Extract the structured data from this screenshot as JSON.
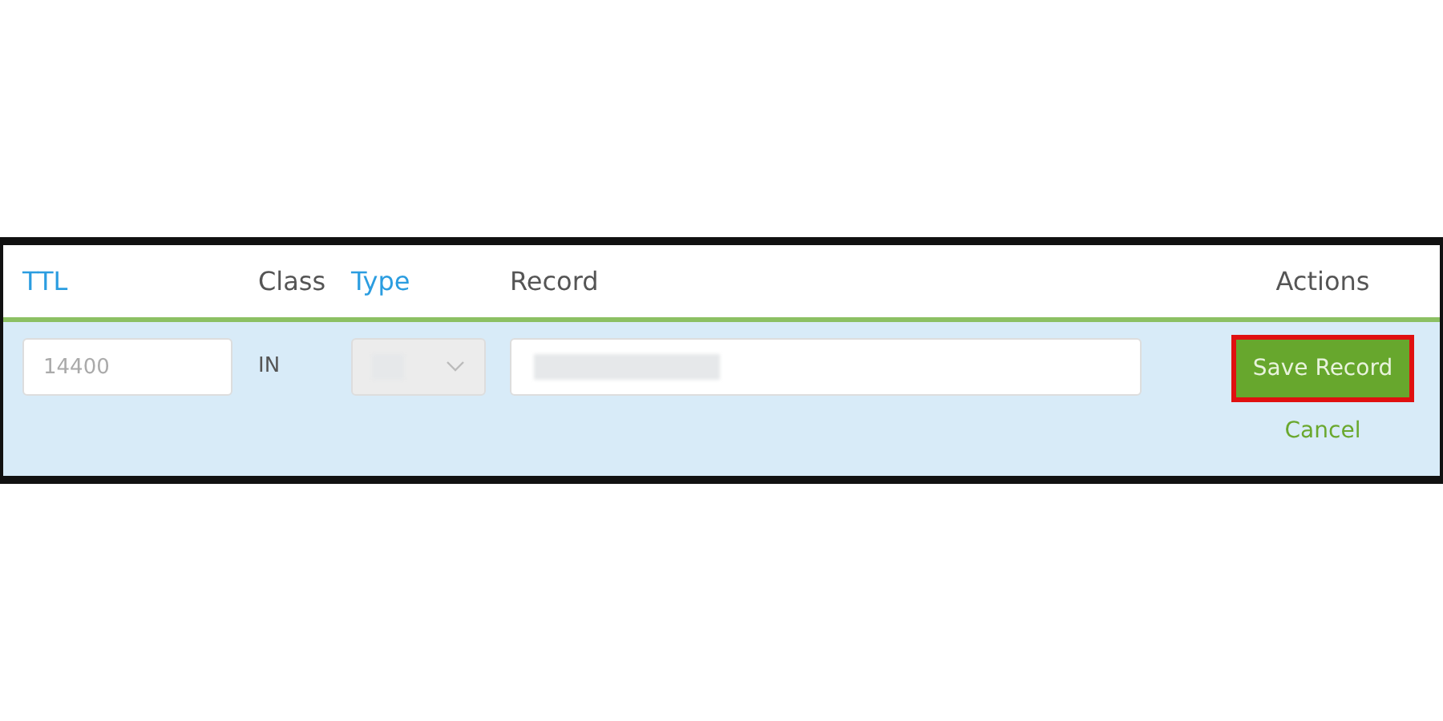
{
  "columns": [
    {
      "label": "TTL",
      "sortable": true
    },
    {
      "label": "Class",
      "sortable": false
    },
    {
      "label": "Type",
      "sortable": true
    },
    {
      "label": "Record",
      "sortable": false
    },
    {
      "label": "Actions",
      "sortable": false
    }
  ],
  "row": {
    "ttl": {
      "placeholder": "14400"
    },
    "class": "IN",
    "type": {
      "disabled": true
    },
    "record": {
      "redacted": true
    },
    "save_button": {
      "label": "Save Record",
      "highlighted": true
    },
    "cancel_link": "Cancel"
  }
}
